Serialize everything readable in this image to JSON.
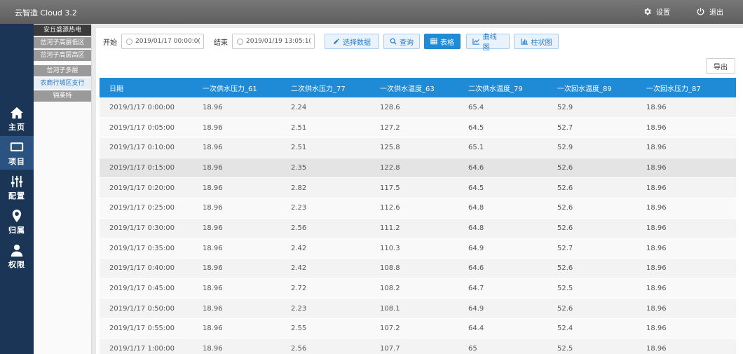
{
  "app": {
    "title": "云智造 Cloud 3.2",
    "settings_label": "设置",
    "logout_label": "退出"
  },
  "nav": {
    "items": [
      {
        "label": "主页",
        "icon": "home-icon"
      },
      {
        "label": "项目",
        "icon": "monitor-icon"
      },
      {
        "label": "配置",
        "icon": "sliders-icon"
      },
      {
        "label": "归属",
        "icon": "location-pin-icon"
      },
      {
        "label": "权限",
        "icon": "user-icon"
      }
    ],
    "active": "项目"
  },
  "projects": {
    "items": [
      "安丘盛源热电",
      "岔河子高层低区",
      "岔河子高层高区",
      "岔河子多层",
      "农商行城区支行",
      "锦莱特"
    ],
    "selected": "农商行城区支行"
  },
  "filters": {
    "start_label": "开始",
    "start_value": "2019/01/17 00:00:0(",
    "end_label": "结束",
    "end_value": "2019/01/19 13:05:1(",
    "select_data_label": "选择数据",
    "query_label": "查询",
    "table_label": "表格",
    "line_chart_label": "曲线图",
    "bar_chart_label": "柱状图",
    "export_label": "导出"
  },
  "colors": {
    "accent": "#1f8ad5",
    "nav_bg": "#1b3557",
    "nav_active": "#2b5382"
  },
  "table": {
    "columns": [
      "日期",
      "一次供水压力_61",
      "二次供水压力_77",
      "一次供水温度_63",
      "二次供水温度_79",
      "一次回水温度_89",
      "一次回水压力_87"
    ],
    "rows": [
      [
        "2019/1/17 0:00:00",
        "18.96",
        "2.24",
        "128.6",
        "65.4",
        "52.9",
        "18.96"
      ],
      [
        "2019/1/17 0:05:00",
        "18.96",
        "2.51",
        "127.2",
        "64.5",
        "52.7",
        "18.96"
      ],
      [
        "2019/1/17 0:10:00",
        "18.96",
        "2.51",
        "125.8",
        "65.1",
        "52.9",
        "18.96"
      ],
      [
        "2019/1/17 0:15:00",
        "18.96",
        "2.35",
        "122.8",
        "64.6",
        "52.6",
        "18.96"
      ],
      [
        "2019/1/17 0:20:00",
        "18.96",
        "2.82",
        "117.5",
        "64.5",
        "52.6",
        "18.96"
      ],
      [
        "2019/1/17 0:25:00",
        "18.96",
        "2.23",
        "112.6",
        "64.8",
        "52.6",
        "18.96"
      ],
      [
        "2019/1/17 0:30:00",
        "18.96",
        "2.56",
        "111.2",
        "64.8",
        "52.6",
        "18.96"
      ],
      [
        "2019/1/17 0:35:00",
        "18.96",
        "2.42",
        "110.3",
        "64.9",
        "52.7",
        "18.96"
      ],
      [
        "2019/1/17 0:40:00",
        "18.96",
        "2.42",
        "108.8",
        "64.6",
        "52.6",
        "18.96"
      ],
      [
        "2019/1/17 0:45:00",
        "18.96",
        "2.72",
        "108.2",
        "64.7",
        "52.5",
        "18.96"
      ],
      [
        "2019/1/17 0:50:00",
        "18.96",
        "2.23",
        "108.1",
        "64.9",
        "52.6",
        "18.96"
      ],
      [
        "2019/1/17 0:55:00",
        "18.96",
        "2.55",
        "107.2",
        "64.4",
        "52.4",
        "18.96"
      ],
      [
        "2019/1/17 1:00:00",
        "18.96",
        "2.56",
        "107.7",
        "65",
        "52.5",
        "18.96"
      ]
    ]
  }
}
